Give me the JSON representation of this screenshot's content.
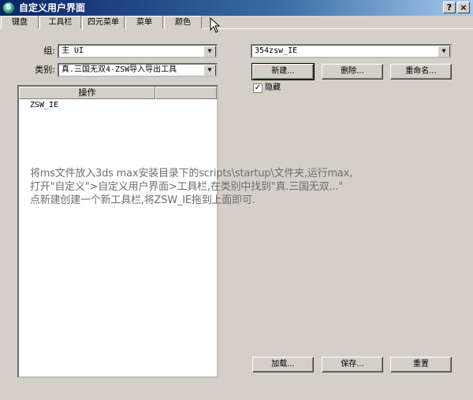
{
  "window": {
    "title": "自定义用户界面",
    "icon": "app-logo-icon"
  },
  "title_buttons": {
    "help": "?",
    "close": "×"
  },
  "tabs": [
    {
      "label": "键盘"
    },
    {
      "label": "工具栏"
    },
    {
      "label": "四元菜单"
    },
    {
      "label": "菜单"
    },
    {
      "label": "颜色"
    }
  ],
  "group": {
    "label": "组:",
    "value": "主 UI"
  },
  "category": {
    "label": "类别:",
    "value": "真.三国无双4-ZSW导入导出工具"
  },
  "list": {
    "header": "操作",
    "items": [
      "ZSW_IE"
    ]
  },
  "toolbar_select": {
    "value": "354zsw_IE"
  },
  "buttons": {
    "new": "新建...",
    "delete": "删除...",
    "rename": "重命名...",
    "load": "加载...",
    "save": "保存...",
    "reset": "重置"
  },
  "hidden_checkbox": {
    "label": "隐藏",
    "checked": true,
    "mark": "✓"
  },
  "note_lines": [
    "将ms文件放入3ds max安装目录下的scripts\\startup\\文件夹,运行max,",
    "打开\"自定义\">自定义用户界面>工具栏,在类别中找到\"真.三国无双...\"",
    "点新建创建一个新工具栏,将ZSW_IE拖到上面即可."
  ],
  "colors": {
    "face": "#d4d0c8",
    "title_start": "#0a246a",
    "title_end": "#a6caf0",
    "note_text": "#6e6e6e"
  }
}
